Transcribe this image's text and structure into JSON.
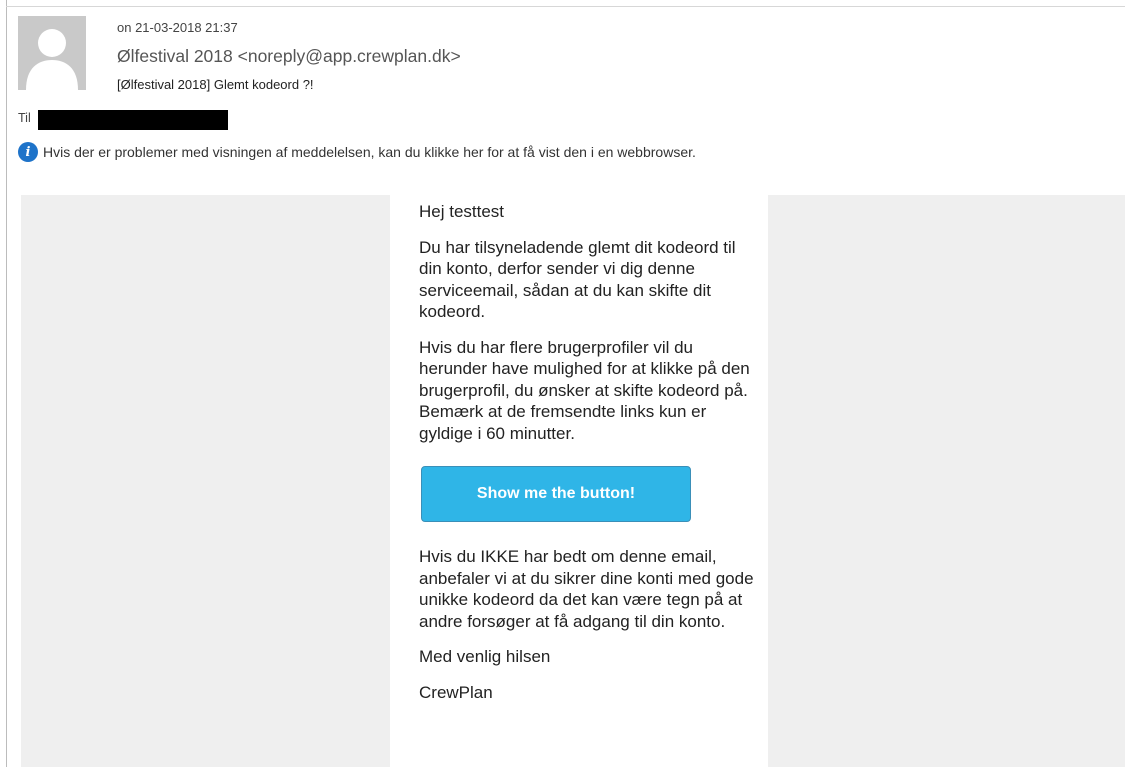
{
  "message": {
    "date": "on 21-03-2018 21:37",
    "from": "Ølfestival 2018 <noreply@app.crewplan.dk>",
    "subject": "[Ølfestival 2018] Glemt kodeord ?!",
    "to_label": "Til",
    "info_text": "Hvis der er problemer med visningen af meddelelsen, kan du klikke her for at få vist den i en webbrowser."
  },
  "body": {
    "greeting": "Hej testtest",
    "paragraph1": "Du har tilsyneladende glemt dit kodeord til din konto, derfor sender vi dig denne serviceemail, sådan at du kan skifte dit kodeord.",
    "paragraph2": "Hvis du har flere brugerprofiler vil du herunder have mulighed for at klikke på den brugerprofil, du ønsker at skifte kodeord på. Bemærk at de fremsendte links kun er gyldige i 60 minutter.",
    "button_label": "Show me the button!",
    "paragraph3": "Hvis du IKKE har bedt om denne email, anbefaler vi at du sikrer dine konti med gode unikke kodeord da det kan være tegn på at andre forsøger at få adgang til din konto.",
    "closing": "Med venlig hilsen",
    "signature": "CrewPlan"
  },
  "colors": {
    "button_bg": "#2fb5e7",
    "info_icon": "#1e73c9",
    "frame_bg": "#efefef"
  },
  "icons": {
    "avatar": "default-person-avatar",
    "info": "info-icon"
  }
}
